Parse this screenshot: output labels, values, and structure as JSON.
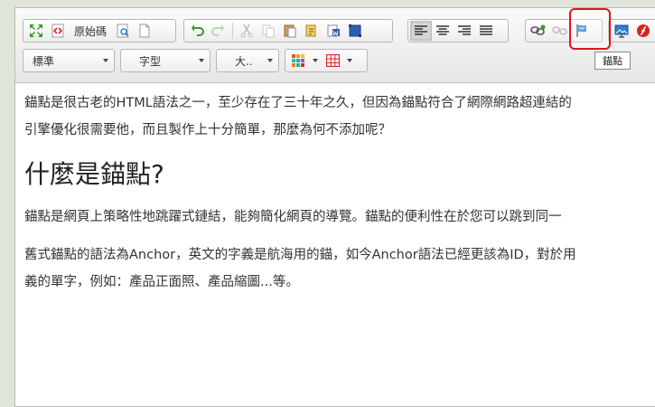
{
  "toolbar": {
    "source_label": "原始碼",
    "tooltip": "錨點",
    "format_combo": "標準",
    "font_combo": "字型",
    "size_combo": "大..",
    "icons": [
      "maximize-icon",
      "source-icon",
      "preview-icon",
      "new-page-icon",
      "undo-icon",
      "redo-icon",
      "cut-icon",
      "copy-icon",
      "paste-icon",
      "paste-text-icon",
      "paste-word-icon",
      "select-all-icon",
      "align-left-icon",
      "align-center-icon",
      "align-right-icon",
      "align-justify-icon",
      "link-icon",
      "unlink-icon",
      "anchor-icon",
      "image-icon",
      "flash-icon",
      "color-grid-icon",
      "table-icon"
    ]
  },
  "content": {
    "p1_line1": "錨點是很古老的HTML語法之一，至少存在了三十年之久，但因為錨點符合了網際網路超連結的",
    "p1_line2": "引擎優化很需要他，而且製作上十分簡單，那麼為何不添加呢？",
    "heading": "什麼是錨點?",
    "p2": "錨點是網頁上策略性地跳躍式鏈結，能夠簡化網頁的導覽。錨點的便利性在於您可以跳到同一",
    "p3_line1": "舊式錨點的語法為Anchor，英文的字義是航海用的錨，如今Anchor語法已經更該為ID，對於用",
    "p3_line2": "義的單字，例如：產品正面照、產品縮圖...等。"
  },
  "colors": {
    "highlight": "#e0141e",
    "undo_green": "#3a9a2a",
    "anchor_blue": "#2d7fd4",
    "flash_red": "#d8251c"
  }
}
